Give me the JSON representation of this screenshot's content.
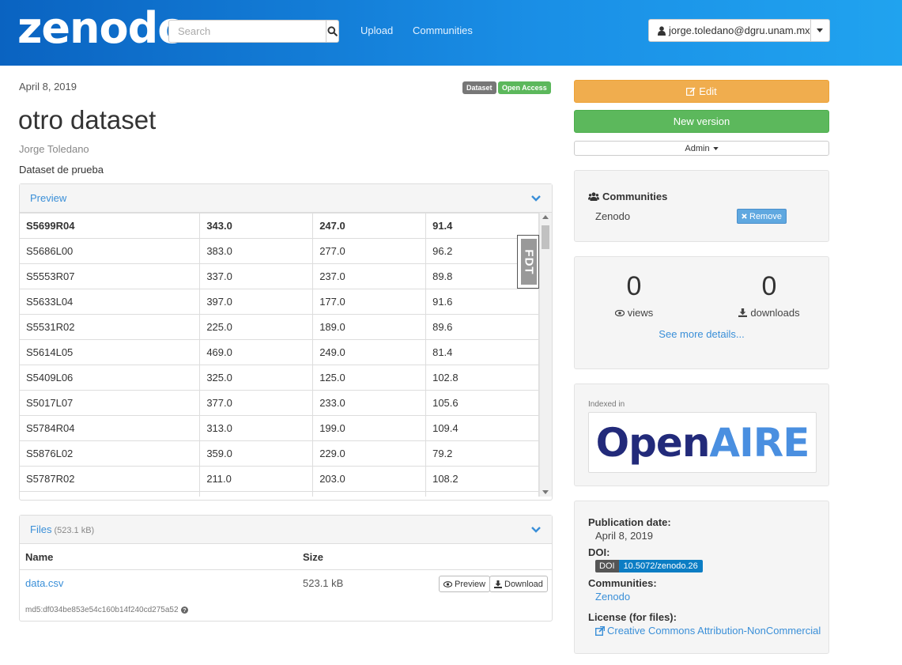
{
  "header": {
    "logo": "zenodo",
    "search_placeholder": "Search",
    "nav": [
      "Upload",
      "Communities"
    ],
    "user_email": "jorge.toledano@dgru.unam.mx"
  },
  "record": {
    "date": "April 8, 2019",
    "badges": [
      "Dataset",
      "Open Access"
    ],
    "title": "otro dataset",
    "author": "Jorge Toledano",
    "description": "Dataset de prueba"
  },
  "preview": {
    "title": "Preview",
    "fdt_label": "FDT",
    "rows": [
      [
        "S5699R04",
        "343.0",
        "247.0",
        "91.4"
      ],
      [
        "S5686L00",
        "383.0",
        "277.0",
        "96.2"
      ],
      [
        "S5553R07",
        "337.0",
        "237.0",
        "89.8"
      ],
      [
        "S5633L04",
        "397.0",
        "177.0",
        "91.6"
      ],
      [
        "S5531R02",
        "225.0",
        "189.0",
        "89.6"
      ],
      [
        "S5614L05",
        "469.0",
        "249.0",
        "81.4"
      ],
      [
        "S5409L06",
        "325.0",
        "125.0",
        "102.8"
      ],
      [
        "S5017L07",
        "377.0",
        "233.0",
        "105.6"
      ],
      [
        "S5784R04",
        "313.0",
        "199.0",
        "109.4"
      ],
      [
        "S5876L02",
        "359.0",
        "229.0",
        "79.2"
      ],
      [
        "S5787R02",
        "211.0",
        "203.0",
        "108.2"
      ],
      [
        "",
        "",
        "",
        ""
      ]
    ]
  },
  "files": {
    "title": "Files",
    "total_size": "(523.1 kB)",
    "col_name": "Name",
    "col_size": "Size",
    "file_name": "data.csv",
    "file_size": "523.1 kB",
    "preview_label": "Preview",
    "download_label": "Download",
    "md5": "md5:df034be853e54c160b14f240cd275a52"
  },
  "actions": {
    "edit": "Edit",
    "new_version": "New version",
    "admin": "Admin"
  },
  "communities": {
    "title": "Communities",
    "name": "Zenodo",
    "remove": "Remove"
  },
  "stats": {
    "views": "0",
    "views_label": "views",
    "downloads": "0",
    "downloads_label": "downloads",
    "more": "See more details..."
  },
  "indexed": {
    "label": "Indexed in",
    "logo_a": "Open",
    "logo_b": "AIRE"
  },
  "meta": {
    "pub_label": "Publication date:",
    "pub_value": "April 8, 2019",
    "doi_label": "DOI:",
    "doi_prefix": "DOI",
    "doi_value": "10.5072/zenodo.26",
    "comm_label": "Communities:",
    "comm_value": "Zenodo",
    "license_label": "License (for files):",
    "license_value": "Creative Commons Attribution-NonCommercial"
  },
  "colors": {
    "header_start": "#0a63c1",
    "header_end": "#20a3ef",
    "link": "#3a8fd8",
    "edit": "#f0ad4e",
    "new_version": "#5cb85c",
    "badge_dataset": "#777777",
    "badge_open": "#5cb85c",
    "openaire_dark": "#222a7a",
    "openaire_light": "#4a8fe0"
  }
}
